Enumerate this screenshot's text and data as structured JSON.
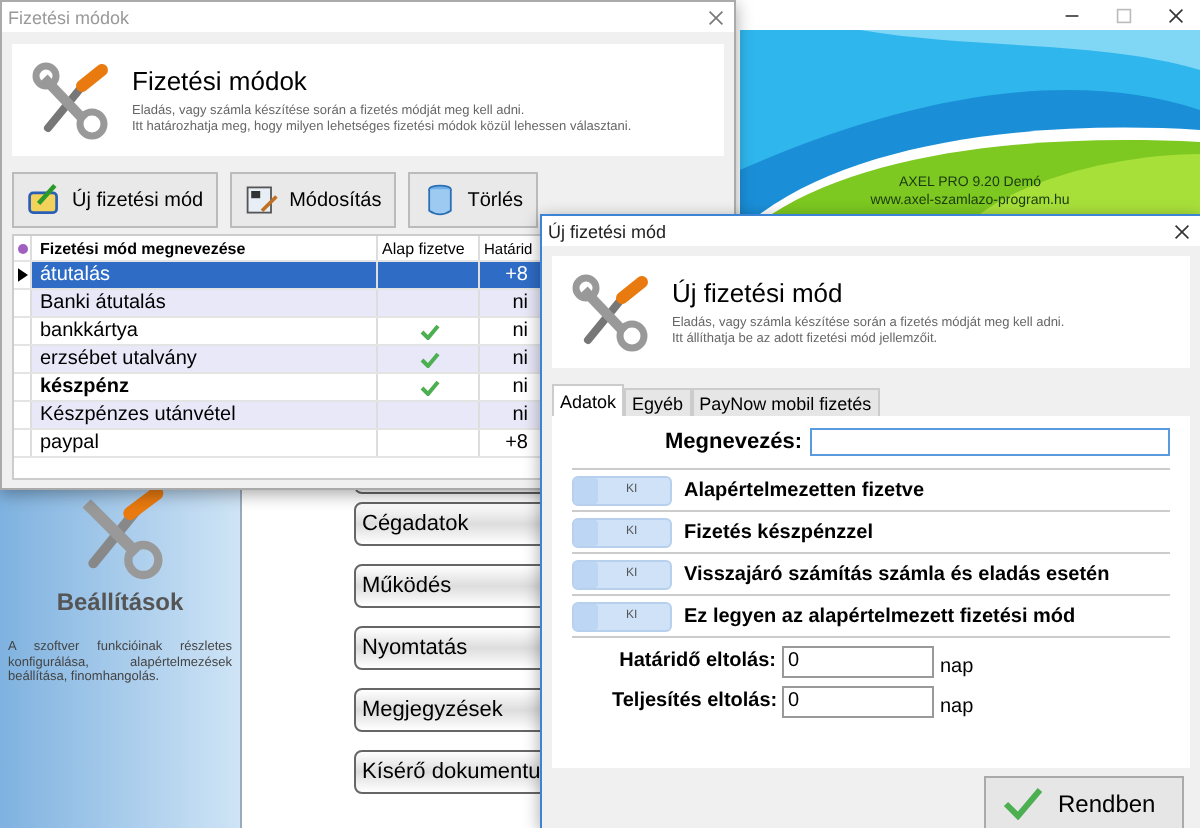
{
  "main_window": {
    "banner": {
      "lines": [
        "AXEL PRO 9.20 Demó",
        "www.axel-szamlazo-program.hu"
      ]
    },
    "side_panel": {
      "title": "Beállítások",
      "description": "A szoftver funkcióinak részletes konfigurálása, alapértelmezések beállítása, finomhangolás."
    },
    "menu_buttons": [
      "Cégadatok",
      "Működés",
      "Nyomtatás",
      "Megjegyzések",
      "Kísérő dokumentu"
    ]
  },
  "list_window": {
    "title": "Fizetési módok",
    "header": {
      "title": "Fizetési módok",
      "description": [
        "Eladás, vagy számla készítése során a fizetés módját meg kell adni.",
        "Itt határozhatja meg, hogy milyen lehetséges fizetési módok közül lehessen választani."
      ]
    },
    "toolbar": [
      {
        "label": "Új fizetési mód",
        "kind": "new"
      },
      {
        "label": "Módosítás",
        "kind": "edit"
      },
      {
        "label": "Törlés",
        "kind": "delete"
      }
    ],
    "table": {
      "columns": [
        "Fizetési mód megnevezése",
        "Alap fizetve",
        "Határid"
      ],
      "rows": [
        {
          "name": "átutalás",
          "default_paid": false,
          "bold": false,
          "column_3": "+8",
          "selected": true
        },
        {
          "name": "Banki átutalás",
          "default_paid": false,
          "bold": false,
          "column_3": "ni",
          "selected": false
        },
        {
          "name": "bankkártya",
          "default_paid": true,
          "bold": false,
          "column_3": "ni",
          "selected": false
        },
        {
          "name": "erzsébet utalvány",
          "default_paid": true,
          "bold": false,
          "column_3": "ni",
          "selected": false
        },
        {
          "name": "készpénz",
          "default_paid": true,
          "bold": true,
          "column_3": "ni",
          "selected": false
        },
        {
          "name": "Készpénzes utánvétel",
          "default_paid": false,
          "bold": false,
          "column_3": "ni",
          "selected": false
        },
        {
          "name": "paypal",
          "default_paid": false,
          "bold": false,
          "column_3": "+8",
          "selected": false
        }
      ]
    }
  },
  "dialog": {
    "title": "Új fizetési mód",
    "header": {
      "title": "Új fizetési mód",
      "description": [
        "Eladás, vagy számla készítése során a fizetés módját meg kell adni.",
        "Itt állíthatja be az adott fizetési mód jellemzőit."
      ]
    },
    "tabs": [
      {
        "label": "Adatok",
        "selected": true
      },
      {
        "label": "Egyéb",
        "selected": false
      },
      {
        "label": "PayNow mobil fizetés",
        "selected": false
      }
    ],
    "name_field": {
      "label": "Megnevezés:"
    },
    "toggles": [
      {
        "label": "Alapértelmezetten fizetve",
        "state_text": "KI",
        "on": false
      },
      {
        "label": "Fizetés készpénzzel",
        "state_text": "KI",
        "on": false
      },
      {
        "label": "Visszajáró számítás számla és eladás esetén",
        "state_text": "KI",
        "on": false
      },
      {
        "label": "Ez legyen az alapértelmezett fizetési mód",
        "state_text": "KI",
        "on": false
      }
    ],
    "offsets": [
      {
        "label": "Határidő eltolás:",
        "value": "0",
        "unit": "nap"
      },
      {
        "label": "Teljesítés eltolás:",
        "value": "0",
        "unit": "nap"
      }
    ],
    "ok_button": "Rendben"
  }
}
